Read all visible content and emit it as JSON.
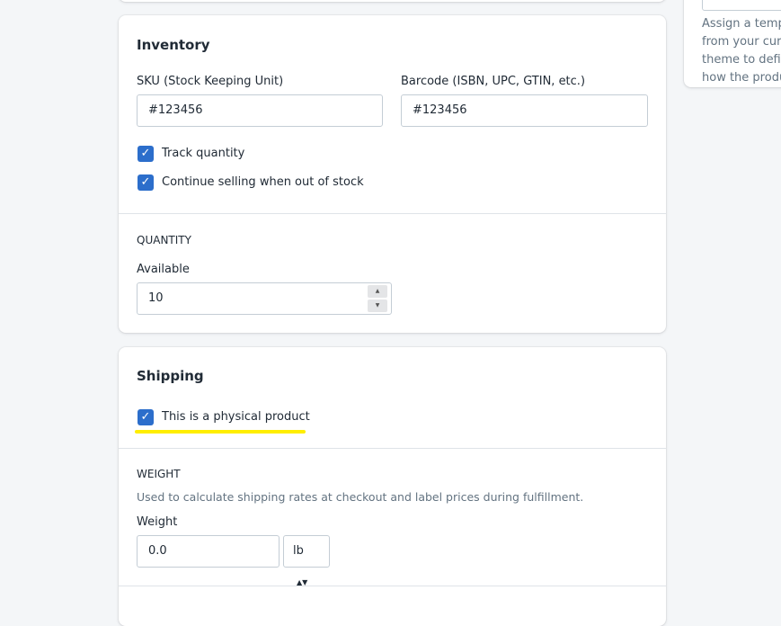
{
  "inventory": {
    "title": "Inventory",
    "sku_label": "SKU (Stock Keeping Unit)",
    "sku_value": "#123456",
    "barcode_label": "Barcode (ISBN, UPC, GTIN, etc.)",
    "barcode_value": "#123456",
    "track_quantity": "Track quantity",
    "continue_selling": "Continue selling when out of stock",
    "quantity_heading": "QUANTITY",
    "available_label": "Available",
    "available_value": "10"
  },
  "shipping": {
    "title": "Shipping",
    "physical_product": "This is a physical product",
    "weight_heading": "WEIGHT",
    "weight_help": "Used to calculate shipping rates at checkout and label prices during fulfillment.",
    "weight_label": "Weight",
    "weight_value": "0.0",
    "unit": "lb"
  },
  "sidebar": {
    "template_help": "Assign a template from your current theme to define how the product is displayed."
  },
  "colors": {
    "accent": "#2c6ecb",
    "highlight": "#ffee00"
  }
}
